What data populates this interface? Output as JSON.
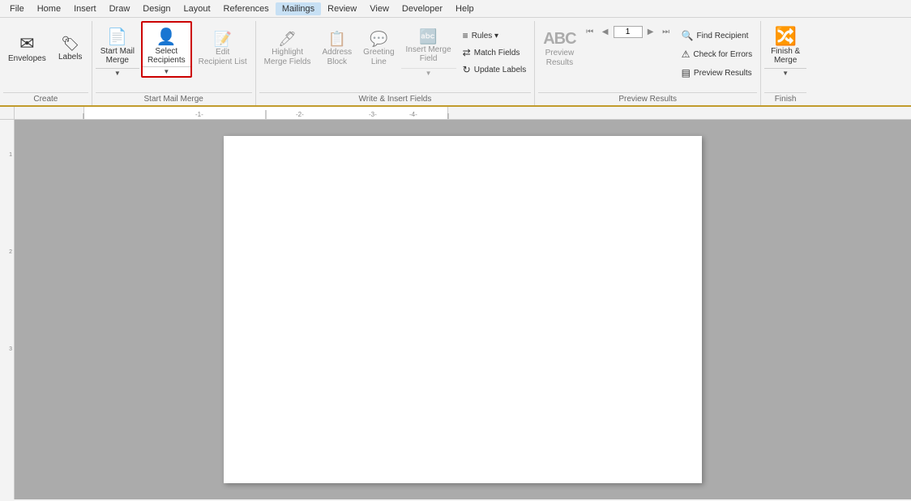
{
  "menu": {
    "items": [
      {
        "label": "File",
        "active": false
      },
      {
        "label": "Home",
        "active": false
      },
      {
        "label": "Insert",
        "active": false
      },
      {
        "label": "Draw",
        "active": false
      },
      {
        "label": "Design",
        "active": false
      },
      {
        "label": "Layout",
        "active": false
      },
      {
        "label": "References",
        "active": false
      },
      {
        "label": "Mailings",
        "active": true
      },
      {
        "label": "Review",
        "active": false
      },
      {
        "label": "View",
        "active": false
      },
      {
        "label": "Developer",
        "active": false
      },
      {
        "label": "Help",
        "active": false
      }
    ]
  },
  "ribbon": {
    "groups": [
      {
        "name": "Create",
        "label": "Create",
        "buttons": [
          {
            "id": "envelopes",
            "label": "Envelopes",
            "icon": "✉",
            "selected": false
          },
          {
            "id": "labels",
            "label": "Labels",
            "icon": "🏷",
            "selected": false
          }
        ]
      },
      {
        "name": "StartMailMerge",
        "label": "Start Mail Merge",
        "buttons": [
          {
            "id": "start-mail-merge",
            "label": "Start Mail\nMerge",
            "icon": "📄",
            "split": true
          },
          {
            "id": "select-recipients",
            "label": "Select\nRecipients",
            "icon": "👤",
            "selected": true,
            "split": true
          },
          {
            "id": "edit-recipient-list",
            "label": "Edit\nRecipient List",
            "icon": "📝",
            "disabled": true
          }
        ]
      },
      {
        "name": "WriteInsertFields",
        "label": "Write & Insert Fields",
        "buttons": [
          {
            "id": "highlight-merge-fields",
            "label": "Highlight\nMerge Fields",
            "icon": "🖊",
            "disabled": true
          },
          {
            "id": "address-block",
            "label": "Address\nBlock",
            "icon": "📋",
            "disabled": true
          },
          {
            "id": "greeting-line",
            "label": "Greeting\nLine",
            "icon": "💬",
            "disabled": true
          },
          {
            "id": "insert-merge-field",
            "label": "Insert Merge\nField",
            "icon": "🔤",
            "disabled": true,
            "split": true
          }
        ],
        "smallButtons": [
          {
            "id": "rules",
            "label": "Rules",
            "icon": "≡",
            "dropdown": true
          },
          {
            "id": "match-fields",
            "label": "Match Fields",
            "icon": "⇌"
          },
          {
            "id": "update-labels",
            "label": "Update Labels",
            "icon": "↻"
          }
        ]
      },
      {
        "name": "PreviewResults",
        "label": "Preview Results",
        "previewBtn": {
          "id": "preview-results",
          "label": "Preview\nResults",
          "icon": "ABC"
        },
        "navButtons": {
          "first": "⏮",
          "prev": "◀",
          "next": "▶",
          "last": "⏭",
          "record": "1"
        },
        "smallButtons": [
          {
            "id": "find-recipient",
            "label": "Find Recipient",
            "icon": "🔍"
          },
          {
            "id": "check-for-errors",
            "label": "Check for Errors",
            "icon": "⚠"
          },
          {
            "id": "preview-results-small",
            "label": "Preview Results",
            "icon": "▤"
          }
        ]
      },
      {
        "name": "Finish",
        "label": "Finish",
        "buttons": [
          {
            "id": "finish-merge",
            "label": "Finish &\nMerge",
            "icon": "✅",
            "dropdown": true
          }
        ]
      }
    ]
  },
  "ruler": {
    "whiteStart": 85,
    "whiteWidth": 450
  },
  "leftRulerMarks": [
    {
      "pos": 40,
      "val": "1"
    },
    {
      "pos": 160,
      "val": "2"
    },
    {
      "pos": 280,
      "val": "3"
    }
  ]
}
